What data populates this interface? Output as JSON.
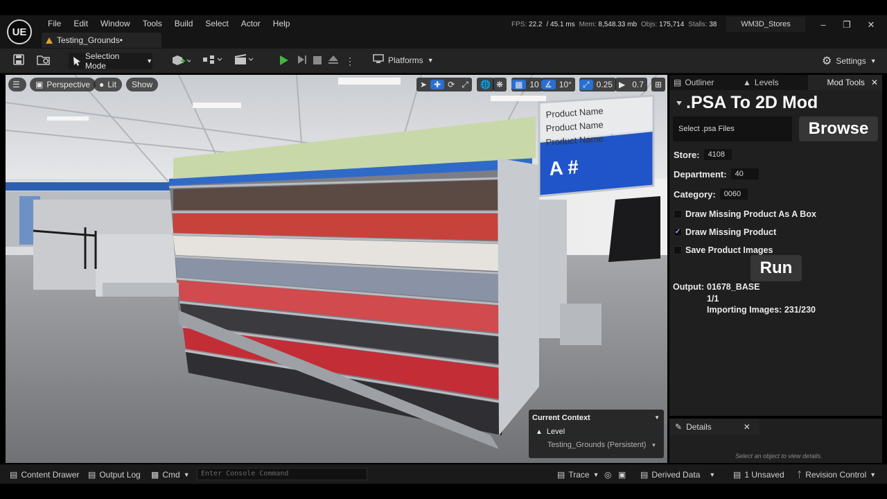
{
  "app": {
    "logo": "UE"
  },
  "menu": [
    "File",
    "Edit",
    "Window",
    "Tools",
    "Build",
    "Select",
    "Actor",
    "Help"
  ],
  "document_tab": "Testing_Grounds•",
  "stats": {
    "fps_label": "FPS:",
    "fps": "22.2",
    "ms": "/ 45.1 ms",
    "mem_label": "Mem:",
    "mem": "8,548.33 mb",
    "objs_label": "Objs:",
    "objs": "175,714",
    "stalls_label": "Stalls:",
    "stalls": "38"
  },
  "project_name": "WM3D_Stores",
  "window_controls": {
    "minimize": "–",
    "restore": "❐",
    "close": "✕"
  },
  "toolbar": {
    "selection_mode": "Selection Mode",
    "platforms": "Platforms",
    "settings": "Settings"
  },
  "viewport": {
    "perspective": "Perspective",
    "lit": "Lit",
    "show": "Show",
    "grid_snap": "10",
    "rotation_snap": "10°",
    "scale_snap": "0.25",
    "camera_speed": "0.7",
    "signage": {
      "product_name": "Product Name",
      "aisle_label": "A #"
    },
    "context": {
      "title": "Current Context",
      "level": "Level",
      "persistent": "Testing_Grounds (Persistent)"
    }
  },
  "panel": {
    "tabs": [
      "Outliner",
      "Levels",
      "Mod Tools"
    ],
    "title": ".PSA To 2D Mod",
    "select_placeholder": "Select .psa Files",
    "browse": "Browse",
    "store_label": "Store:",
    "store_value": "4108",
    "department_label": "Department:",
    "department_value": "40",
    "category_label": "Category:",
    "category_value": "0060",
    "checkboxes": [
      {
        "label": "Draw Missing Product As A Box",
        "checked": false
      },
      {
        "label": "Draw Missing Product",
        "checked": true
      },
      {
        "label": "Save Product Images",
        "checked": false
      }
    ],
    "run": "Run",
    "output_label": "Output:",
    "output_value": "01678_BASE",
    "progress": "1/1",
    "importing": "Importing Images: 231/230"
  },
  "details": {
    "tab": "Details",
    "hint": "Select an object to view details."
  },
  "statusbar": {
    "content_drawer": "Content Drawer",
    "output_log": "Output Log",
    "cmd": "Cmd",
    "console_placeholder": "Enter Console Command",
    "trace": "Trace",
    "derived_data": "Derived Data",
    "unsaved": "1 Unsaved",
    "revision_control": "Revision Control"
  },
  "colors": {
    "accent_blue": "#2a6fcf",
    "play_green": "#42b83a",
    "panel_bg": "#1f1f1f",
    "sign_blue": "#1f55c8"
  }
}
